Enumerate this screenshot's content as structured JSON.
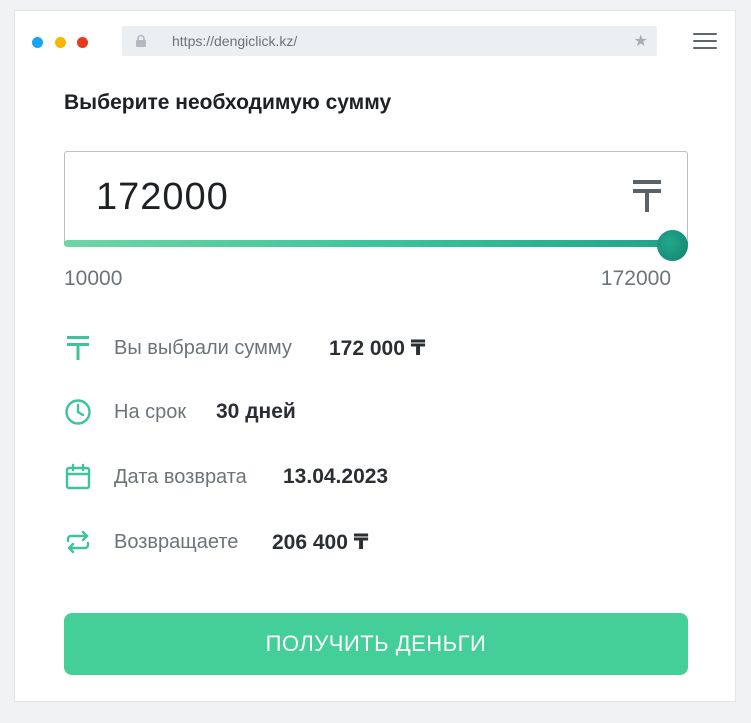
{
  "browser": {
    "url": "https://dengiclick.kz/"
  },
  "page": {
    "title": "Выберите необходимую сумму"
  },
  "calculator": {
    "amount": "172000",
    "currency_symbol": "₸",
    "range_min": "10000",
    "range_max": "172000",
    "slider_fraction": 1.0
  },
  "summary": {
    "amount_label": "Вы выбрали сумму",
    "amount_value": "172 000 ₸",
    "term_label": "На срок",
    "term_value": "30 дней",
    "return_date_label": "Дата возврата",
    "return_date_value": "13.04.2023",
    "repay_label": "Возвращаете",
    "repay_value": "206 400 ₸"
  },
  "cta": {
    "label": "ПОЛУЧИТЬ ДЕНЬГИ"
  },
  "colors": {
    "accent": "#43cf97",
    "slider_end": "#1ea38a",
    "icon": "#3ec49a"
  }
}
